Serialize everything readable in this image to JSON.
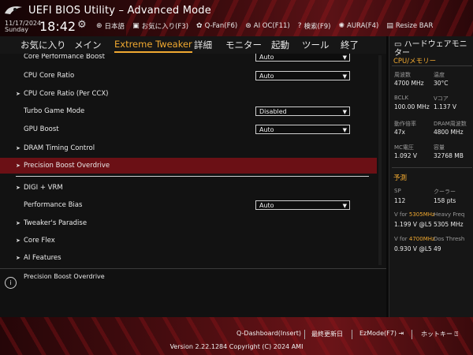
{
  "header": {
    "title": "UEFI BIOS Utility – Advanced Mode",
    "date": "11/17/2024",
    "day": "Sunday",
    "time": "18:42",
    "toolbar": [
      {
        "icon": "globe-icon",
        "glyph": "⊕",
        "label": "日本語"
      },
      {
        "icon": "star-document-icon",
        "glyph": "▣",
        "label": "お気に入り(F3)"
      },
      {
        "icon": "fan-icon",
        "glyph": "✿",
        "label": "Q-Fan(F6)"
      },
      {
        "icon": "ai-oc-icon",
        "glyph": "⊛",
        "label": "AI OC(F11)"
      },
      {
        "icon": "help-icon",
        "glyph": "?",
        "label": "検索(F9)"
      },
      {
        "icon": "aura-icon",
        "glyph": "✺",
        "label": "AURA(F4)"
      },
      {
        "icon": "resize-bar-icon",
        "glyph": "▤",
        "label": "Resize BAR"
      }
    ]
  },
  "menu": {
    "items": [
      "お気に入り",
      "メイン",
      "Extreme Tweaker",
      "詳細",
      "モニター",
      "起動",
      "ツール",
      "終了"
    ],
    "active_index": 2
  },
  "settings": {
    "rows": [
      {
        "label": "Core Performance Boost",
        "value": "Auto",
        "submenu": false
      },
      {
        "label": "CPU Core Ratio",
        "value": "Auto",
        "submenu": false
      },
      {
        "label": "CPU Core Ratio (Per CCX)",
        "value": "",
        "submenu": true
      },
      {
        "label": "Turbo Game Mode",
        "value": "Disabled",
        "submenu": false
      },
      {
        "label": "GPU Boost",
        "value": "Auto",
        "submenu": false
      },
      {
        "label": "DRAM Timing Control",
        "value": "",
        "submenu": true
      },
      {
        "label": "Precision Boost Overdrive",
        "value": "",
        "submenu": true,
        "highlighted": true
      },
      {
        "label": "DIGI + VRM",
        "value": "",
        "submenu": true
      },
      {
        "label": "Performance Bias",
        "value": "Auto",
        "submenu": false
      },
      {
        "label": "Tweaker's Paradise",
        "value": "",
        "submenu": true
      },
      {
        "label": "Core Flex",
        "value": "",
        "submenu": true
      },
      {
        "label": "AI Features",
        "value": "",
        "submenu": true
      }
    ]
  },
  "help": {
    "text": "Precision Boost Overdrive"
  },
  "hardware_monitor": {
    "title": "ハードウェアモニター",
    "cpu_section": "CPU/メモリー",
    "cpu": {
      "freq_label": "周波数",
      "freq_value": "4700 MHz",
      "temp_label": "温度",
      "temp_value": "30°C",
      "bclk_label": "BCLK",
      "bclk_value": "100.00 MHz",
      "vcore_label": "Vコア",
      "vcore_value": "1.137 V",
      "ratio_label": "動作倍率",
      "ratio_value": "47x",
      "dram_label": "DRAM周波数",
      "dram_value": "4800 MHz",
      "mc_label": "MC電圧",
      "mc_value": "1.092 V",
      "cap_label": "容量",
      "cap_value": "32768 MB"
    },
    "predict_section": "予測",
    "predict": {
      "sp_label": "SP",
      "sp_value": "112",
      "cooler_label": "クーラー",
      "cooler_value": "158 pts",
      "v_for_1_prefix": "V for ",
      "v_for_1_freq": "5305MHz",
      "heavy_label": "Heavy Freq",
      "v_for_1_value": "1.199 V @L5",
      "heavy_value": "5305 MHz",
      "v_for_2_prefix": "V for ",
      "v_for_2_freq": "4700MHz",
      "dos_label": "Dos Thresh",
      "v_for_2_value": "0.930 V @L5",
      "dos_value": "49"
    }
  },
  "footer": {
    "qdash": "Q-Dashboard(Insert)",
    "last_modified": "最終更新日",
    "ezmode": "EzMode(F7)",
    "hotkeys": "ホットキー",
    "version": "Version 2.22.1284 Copyright (C) 2024 AMI"
  },
  "colors": {
    "accent": "#f0a830",
    "highlight": "#6b1015",
    "brand_red": "#5a1216"
  }
}
